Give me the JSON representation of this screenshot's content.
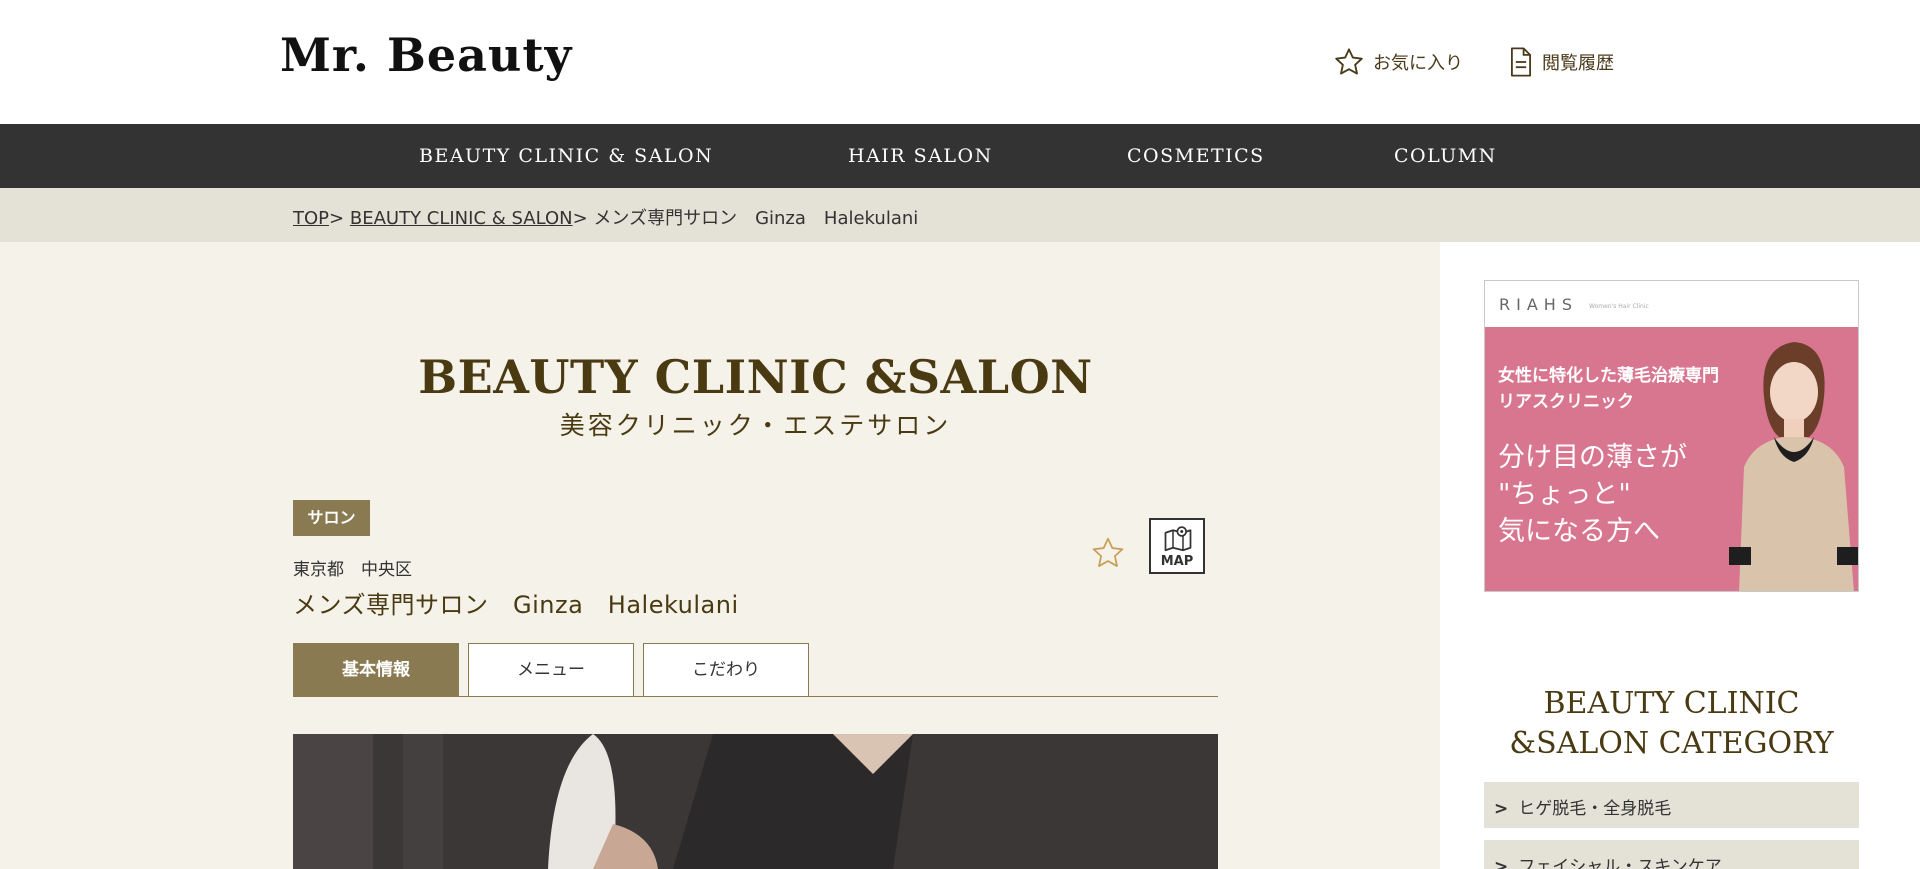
{
  "header": {
    "logo": "Mr. Beauty",
    "favorites_label": "お気に入り",
    "history_label": "閲覧履歴"
  },
  "nav": {
    "items": [
      {
        "label": "BEAUTY CLINIC & SALON"
      },
      {
        "label": "HAIR SALON"
      },
      {
        "label": "COSMETICS"
      },
      {
        "label": "COLUMN"
      }
    ]
  },
  "breadcrumb": {
    "items": [
      "TOP",
      "BEAUTY CLINIC & SALON",
      "メンズ専門サロン　Ginza　Halekulani"
    ],
    "separator": ">"
  },
  "main": {
    "title": "BEAUTY CLINIC &SALON",
    "subtitle": "美容クリニック・エステサロン",
    "tag": "サロン",
    "location": "東京都　中央区",
    "shop_name": "メンズ専門サロン　Ginza　Halekulani",
    "map_label": "MAP",
    "tabs": [
      {
        "label": "基本情報",
        "active": true
      },
      {
        "label": "メニュー",
        "active": false
      },
      {
        "label": "こだわり",
        "active": false
      }
    ]
  },
  "sidebar": {
    "banner": {
      "brand": "RIAHS",
      "brand_sub": "Women's Hair Clinic",
      "line1": "女性に特化した薄毛治療専門",
      "line2": "リアスクリニック",
      "headline1": "分け目の薄さが",
      "headline2": "\"ちょっと\"",
      "headline3": "気になる方へ"
    },
    "category_title_1": "BEAUTY CLINIC",
    "category_title_2": "&SALON CATEGORY",
    "categories": [
      {
        "label": "ヒゲ脱毛・全身脱毛"
      },
      {
        "label": "フェイシャル・スキンケア"
      }
    ]
  },
  "colors": {
    "accent": "#8a7a52",
    "nav_bg": "#333333",
    "breadcrumb_bg": "#e4e1d6",
    "page_bg": "#f5f2ea",
    "title_color": "#4a3a12",
    "banner_pink": "#d8758f"
  }
}
